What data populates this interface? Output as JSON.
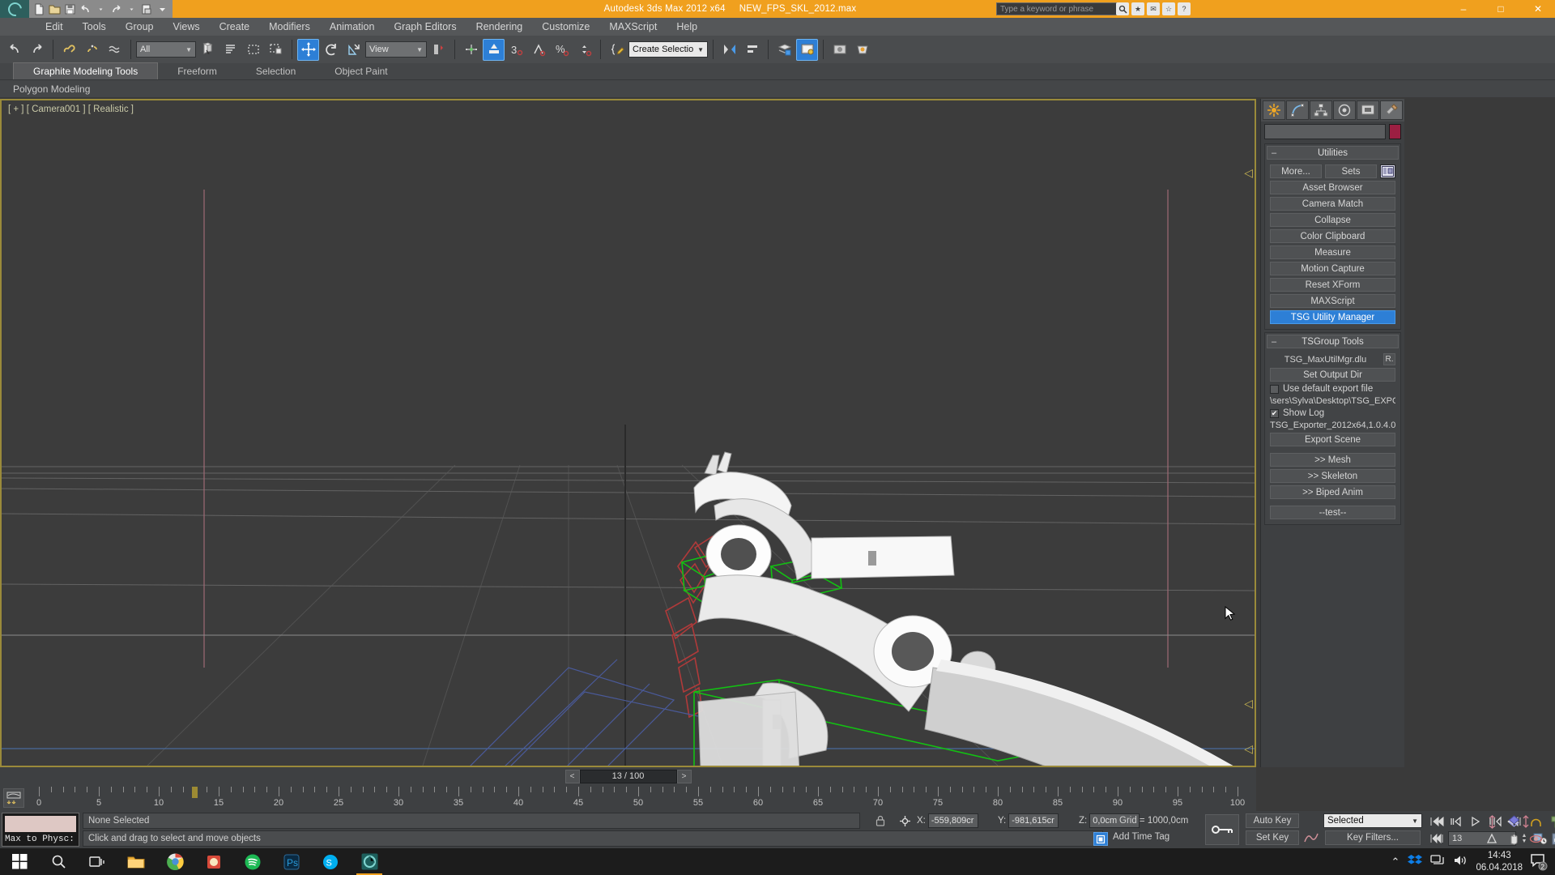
{
  "titlebar": {
    "app_title": "Autodesk 3ds Max  2012 x64",
    "file_name": "NEW_FPS_SKL_2012.max",
    "search_placeholder": "Type a keyword or phrase",
    "quick_access": [
      "new-file-icon",
      "open-file-icon",
      "save-file-icon",
      "undo-icon",
      "redo-icon",
      "set-project-folder-icon",
      "customize-qat-icon"
    ],
    "window_buttons": {
      "minimize": "–",
      "maximize": "□",
      "close": "✕"
    }
  },
  "menubar": {
    "items": [
      "Edit",
      "Tools",
      "Group",
      "Views",
      "Create",
      "Modifiers",
      "Animation",
      "Graph Editors",
      "Rendering",
      "Customize",
      "MAXScript",
      "Help"
    ]
  },
  "toolbar": {
    "selection_filter": "All",
    "reference_coordinate": "View",
    "named_selection_set_placeholder": "Create Selection Se",
    "icons": [
      "undo-scene-icon",
      "redo-scene-icon",
      "select-link-icon",
      "unlink-icon",
      "bind-space-warp-icon",
      "select-object-icon",
      "select-by-name-icon",
      "rect-selection-region-icon",
      "window-crossing-icon",
      "select-and-move-icon",
      "select-and-rotate-icon",
      "select-and-scale-icon",
      "use-pivot-center-icon",
      "snap-toggle-icon",
      "angle-snap-icon",
      "percent-snap-icon",
      "spinner-snap-icon",
      "edit-named-selection-icon",
      "mirror-icon",
      "align-icon",
      "layer-manager-icon",
      "render-setup-icon"
    ]
  },
  "ribbon": {
    "tabs": [
      "Graphite Modeling Tools",
      "Freeform",
      "Selection",
      "Object Paint"
    ],
    "active_tab": "Graphite Modeling Tools",
    "subrow_label": "Polygon Modeling"
  },
  "viewport": {
    "label": "[ + ] [ Camera001 ] [ Realistic ]",
    "grid_color": "#555555",
    "selection_color": "#00c800",
    "bone_color": "#b03030"
  },
  "command_panel": {
    "tabs": [
      "create-tab-icon",
      "modify-tab-icon",
      "hierarchy-tab-icon",
      "motion-tab-icon",
      "display-tab-icon",
      "utilities-tab-icon"
    ],
    "active_tab_index": 5,
    "object_name": "",
    "color_swatch": "#9c1f42",
    "utilities": {
      "title": "Utilities",
      "more_label": "More...",
      "sets_label": "Sets",
      "config_icon": "configure-button-sets-icon",
      "buttons": [
        "Asset Browser",
        "Camera Match",
        "Collapse",
        "Color Clipboard",
        "Measure",
        "Motion Capture",
        "Reset XForm",
        "MAXScript"
      ],
      "highlighted_button": "TSG Utility Manager"
    },
    "tsgroup_tools": {
      "title": "TSGroup Tools",
      "plugin_name": "TSG_MaxUtilMgr.dlu",
      "reload_label": "R.",
      "set_output_dir": "Set Output Dir",
      "use_default_export_file": {
        "label": "Use default export file",
        "checked": false
      },
      "output_path": "\\sers\\Sylva\\Desktop\\TSG_EXPO",
      "show_log": {
        "label": "Show Log",
        "checked": true
      },
      "version_text": "TSG_Exporter_2012x64,1.0.4.0",
      "export_scene": "Export Scene",
      "sub_buttons": [
        ">> Mesh",
        ">> Skeleton",
        ">> Biped Anim"
      ],
      "test_button": "--test--"
    }
  },
  "time_slider": {
    "current_label": "13 / 100",
    "prev_arrow": "<",
    "next_arrow": ">",
    "current_frame": 13,
    "total_frames": 100
  },
  "track_bar": {
    "tick_labels": [
      "0",
      "5",
      "10",
      "15",
      "20",
      "25",
      "30",
      "35",
      "40",
      "45",
      "50",
      "55",
      "60",
      "65",
      "70",
      "75",
      "80",
      "85",
      "90",
      "95",
      "100"
    ],
    "tick_values": [
      0,
      5,
      10,
      15,
      20,
      25,
      30,
      35,
      40,
      45,
      50,
      55,
      60,
      65,
      70,
      75,
      80,
      85,
      90,
      95,
      100
    ],
    "playhead_frame": 13,
    "open_minicurve_icon": "open-mini-curve-editor-icon"
  },
  "status_bar": {
    "max_to_physx_label": "Max to Physc:",
    "selection_status": "None Selected",
    "prompt": "Click and drag to select and move objects",
    "lock_icon": "selection-lock-icon",
    "coords": {
      "x_label": "X:",
      "x_value": "-559,809cr",
      "y_label": "Y:",
      "y_value": "-981,615cr",
      "z_label": "Z:",
      "z_value": "0,0cm"
    },
    "grid_label": "Grid = 1000,0cm",
    "add_time_tag": "Add Time Tag",
    "key_icon": "key-mode-icon",
    "auto_key": "Auto Key",
    "set_key": "Set Key",
    "key_filters": "Key Filters...",
    "key_mode_selector": "Selected",
    "frame_field": "13",
    "playback_icons": [
      "go-to-start-icon",
      "previous-frame-icon",
      "play-animation-icon",
      "next-frame-icon",
      "go-to-end-icon"
    ],
    "nav_icons": [
      "zoom-icon",
      "zoom-all-icon",
      "zoom-extents-icon",
      "zoom-region-icon",
      "pan-view-icon",
      "orbit-icon",
      "maximize-viewport-icon",
      "field-of-view-icon",
      "time-config-icon"
    ]
  },
  "taskbar": {
    "start_icon": "windows-start-icon",
    "items": [
      "search-icon",
      "task-view-icon",
      "file-explorer-icon",
      "chrome-icon",
      "paint-icon",
      "blender-icon",
      "spotify-icon",
      "photoshop-icon",
      "skype-icon",
      "3dsmax-icon"
    ],
    "active_item": "3dsmax-icon",
    "tray_icons": [
      "show-hidden-icons-icon",
      "dropbox-icon",
      "network-icon",
      "volume-icon"
    ],
    "clock_time": "14:43",
    "clock_date": "06.04.2018",
    "notification_count": "2"
  }
}
